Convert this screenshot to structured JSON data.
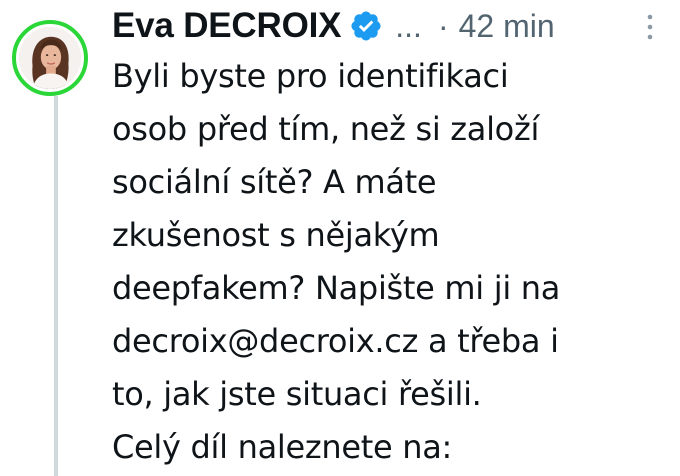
{
  "post": {
    "author_name": "Eva DECROIX",
    "ellipsis": "...",
    "dot": "·",
    "timestamp": "42 min",
    "lines": [
      "Byli byste pro identifikaci",
      "osob před tím, než si založí",
      "sociální sítě? A máte",
      "zkušenost s nějakým",
      "deepfakem? Napište mi ji na",
      "decroix@decroix.cz a třeba i",
      "to, jak jste situaci řešili.",
      "Celý díl naleznete na:"
    ]
  },
  "icons": {
    "verified": "verified-badge-icon",
    "more": "more-vertical-icon"
  },
  "colors": {
    "avatar_ring": "#2bd639",
    "verified_blue": "#1d9bf0",
    "muted_text": "#536471",
    "thread_line": "#cfd9de",
    "text": "#0f1419"
  }
}
